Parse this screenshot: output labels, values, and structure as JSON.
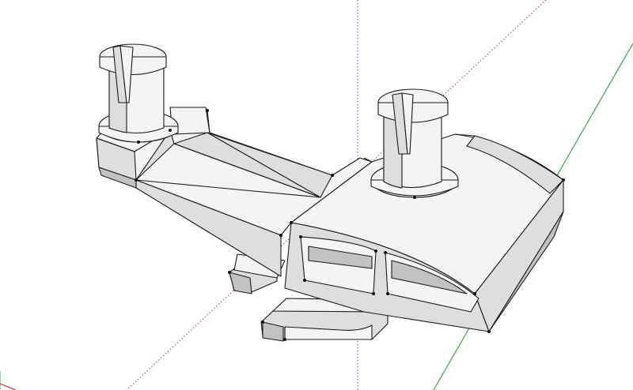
{
  "viewport": {
    "background": "#ffffff",
    "axes": {
      "red": "#c03030",
      "green": "#3aa83a",
      "blue": "#3a55c8"
    },
    "model_colors": {
      "light_face": "#f4f4f4",
      "mid_face": "#dedede",
      "shadow_face": "#c2c2c2",
      "edge": "#1a1a1a"
    }
  }
}
